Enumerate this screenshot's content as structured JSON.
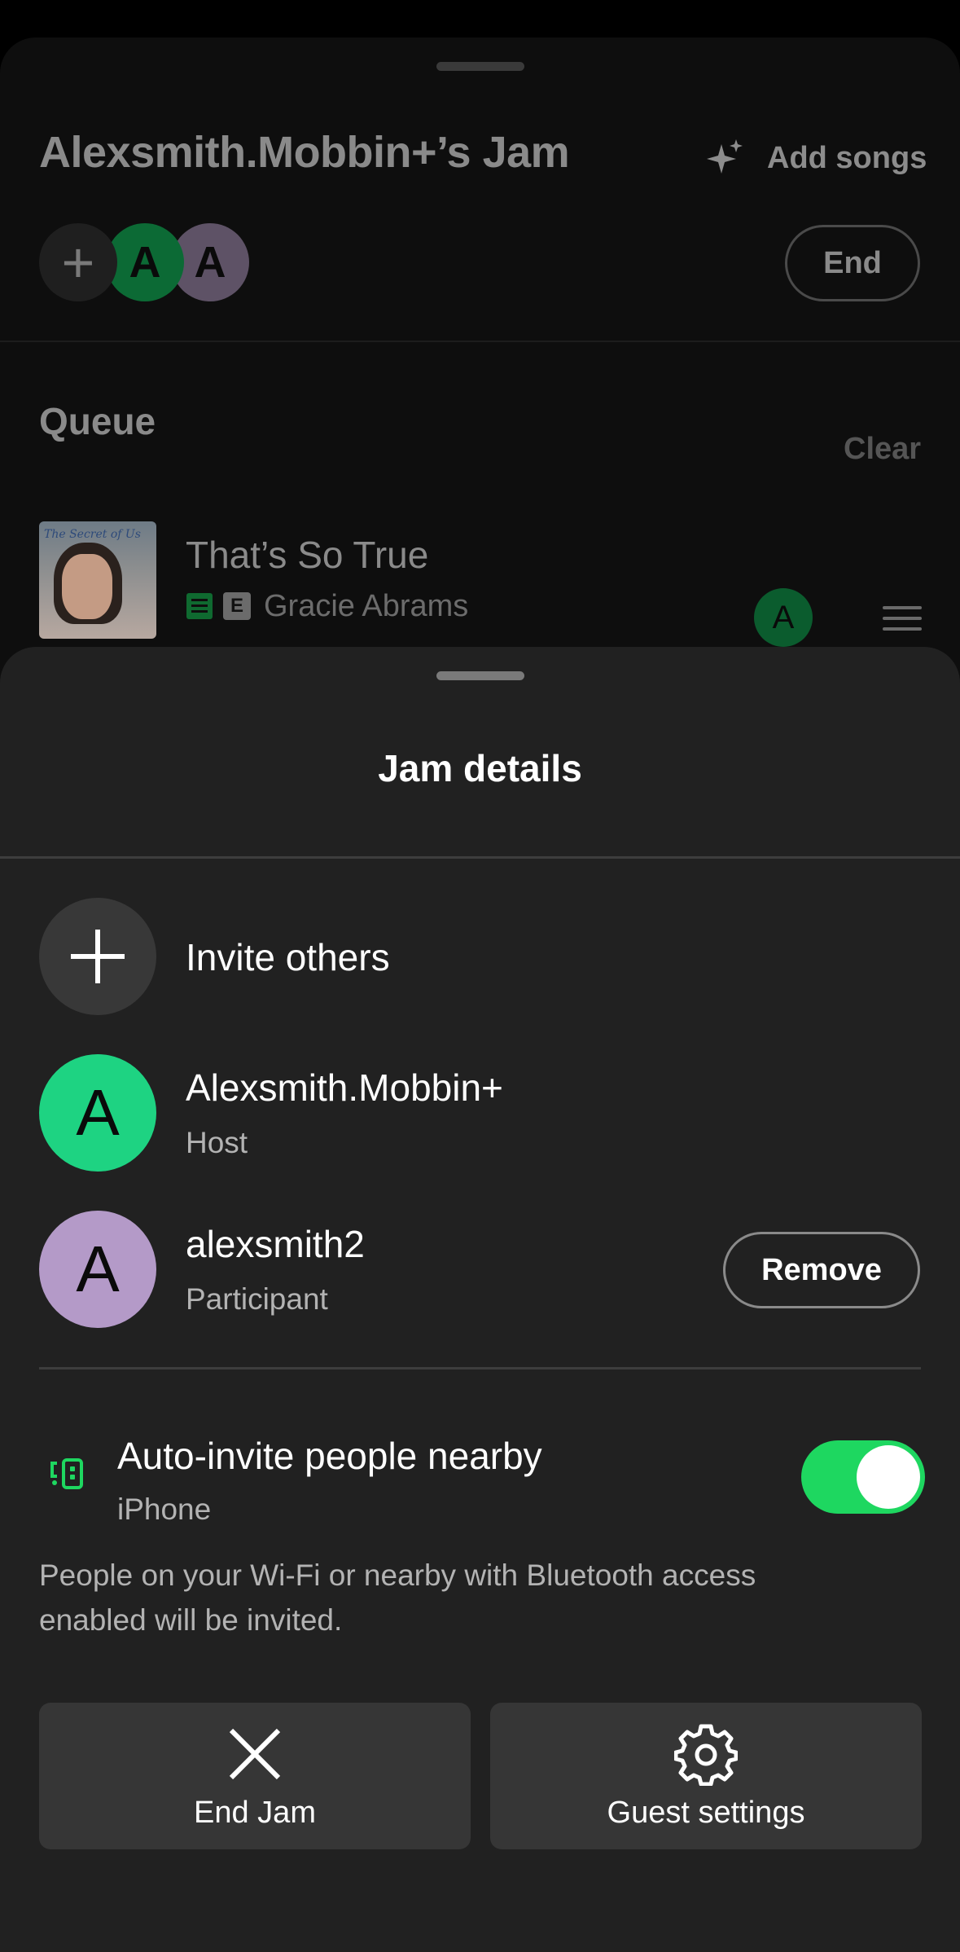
{
  "jam": {
    "title": "Alexsmith.Mobbin+’s Jam",
    "add_songs_label": "Add songs",
    "end_label": "End",
    "add_participant_symbol": "+",
    "avatars": [
      "A",
      "A"
    ],
    "queue_heading": "Queue",
    "clear_label": "Clear",
    "queue": [
      {
        "title": "That’s So True",
        "artist": "Gracie Abrams",
        "explicit_badge": "E",
        "album_text": "The Secret of Us",
        "added_by_initial": "A"
      }
    ]
  },
  "sheet": {
    "title": "Jam details",
    "invite_label": "Invite others",
    "people": [
      {
        "initial": "A",
        "name": "Alexsmith.Mobbin+",
        "role": "Host",
        "color": "#1ed382"
      },
      {
        "initial": "A",
        "name": "alexsmith2",
        "role": "Participant",
        "color": "#b49ac8"
      }
    ],
    "remove_label": "Remove",
    "auto_invite": {
      "title": "Auto-invite people nearby",
      "device": "iPhone",
      "enabled": true,
      "note": "People on your Wi-Fi or nearby with Bluetooth access enabled will be invited."
    },
    "actions": {
      "end_jam_label": "End Jam",
      "guest_settings_label": "Guest settings"
    }
  },
  "icons": {
    "add_songs": "sparkle-icon",
    "invite": "plus-icon",
    "nearby": "nearby-devices-icon",
    "end_jam": "close-icon",
    "guest_settings": "gear-icon",
    "lyrics": "lyrics-icon",
    "reorder": "drag-handle-icon"
  },
  "colors": {
    "accent_green": "#1ed760",
    "host_avatar": "#1ed382",
    "guest_avatar": "#b49ac8",
    "sheet_background": "#212121"
  }
}
